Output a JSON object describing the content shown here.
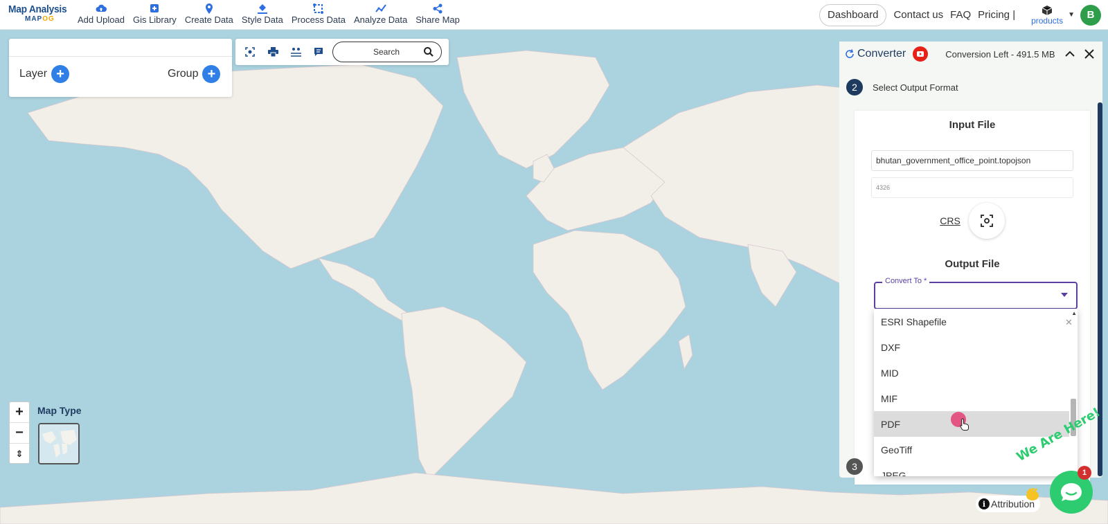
{
  "logo": {
    "title": "Map Analysis",
    "sub_main": "MAP",
    "sub_accent": "OG"
  },
  "nav": [
    {
      "label": "Add Upload",
      "icon": "cloud-upload-icon"
    },
    {
      "label": "Gis Library",
      "icon": "library-icon"
    },
    {
      "label": "Create Data",
      "icon": "map-pin-icon"
    },
    {
      "label": "Style Data",
      "icon": "paint-bucket-icon"
    },
    {
      "label": "Process Data",
      "icon": "process-icon"
    },
    {
      "label": "Analyze Data",
      "icon": "analyze-icon"
    },
    {
      "label": "Share Map",
      "icon": "share-icon"
    }
  ],
  "right_nav": {
    "dashboard": "Dashboard",
    "contact": "Contact us",
    "faq": "FAQ",
    "pricing": "Pricing |",
    "products": "products",
    "avatar": "B"
  },
  "layer_panel": {
    "layer": "Layer",
    "group": "Group"
  },
  "toolbar": {
    "search_placeholder": "Search"
  },
  "map_type": {
    "label": "Map Type"
  },
  "zoom": {
    "in": "+",
    "out": "−",
    "reset": "⇕"
  },
  "converter": {
    "title": "Converter",
    "conversion_left": "Conversion Left - 491.5 MB",
    "step2_num": "2",
    "step2_label": "Select Output Format",
    "input_title": "Input File",
    "input_filename": "bhutan_government_office_point.topojson",
    "crs_value": "4326",
    "crs_label": "CRS",
    "output_title": "Output File",
    "convert_to_label": "Convert To *",
    "step3_num": "3"
  },
  "dropdown": {
    "options": [
      "ESRI Shapefile",
      "DXF",
      "MID",
      "MIF",
      "PDF",
      "GeoTiff",
      "JPEG"
    ],
    "highlighted": "PDF"
  },
  "attribution": "Attribution",
  "chat": {
    "badge": "1",
    "banner": "We Are Here!"
  },
  "colors": {
    "accent": "#2d6fe0",
    "brand": "#1e4f8c",
    "map_water": "#aad3df",
    "map_land": "#f2efe9",
    "chat": "#2ecc71"
  }
}
